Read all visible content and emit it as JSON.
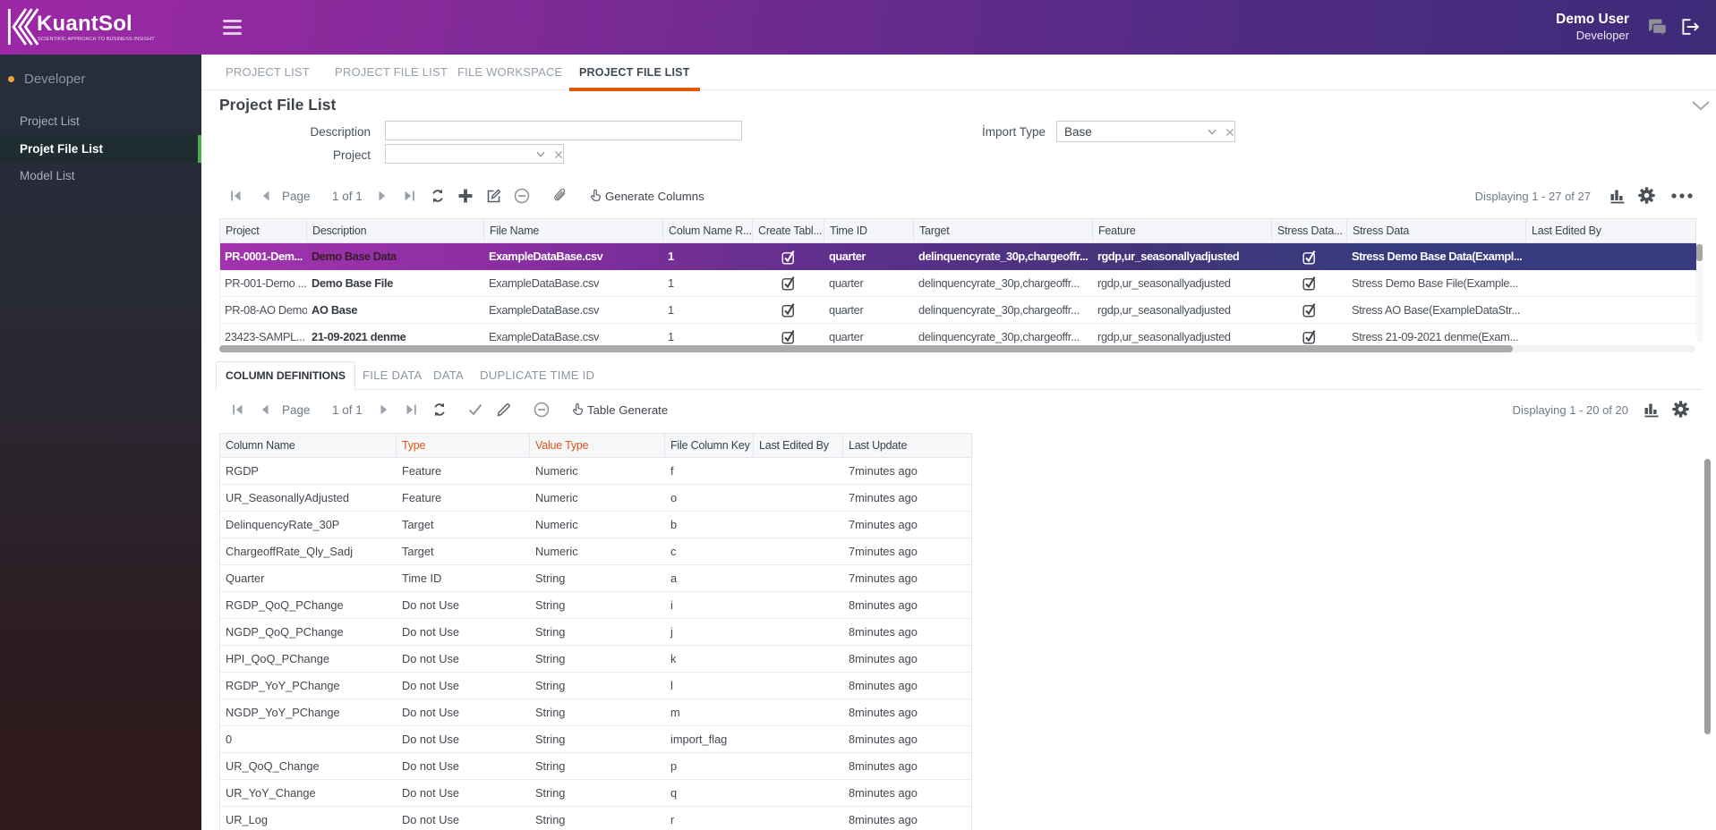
{
  "brand": {
    "name": "KuantSol",
    "tagline": "SCIENTIFIC APPROACH TO BUSINESS INSIGHT"
  },
  "header": {
    "user_name": "Demo User",
    "user_role": "Developer"
  },
  "sidebar": {
    "section_label": "Developer",
    "items": [
      {
        "label": "Project List",
        "active": false
      },
      {
        "label": "Projet File List",
        "active": true
      },
      {
        "label": "Model List",
        "active": false
      }
    ]
  },
  "tabs": [
    {
      "label": "PROJECT LIST",
      "active": false
    },
    {
      "label": "PROJECT FILE LIST",
      "active": false
    },
    {
      "label": "FILE WORKSPACE",
      "active": false
    },
    {
      "label": "PROJECT FILE LIST",
      "active": true
    }
  ],
  "page": {
    "title": "Project File List"
  },
  "filters": {
    "description_label": "Description",
    "description_value": "",
    "project_label": "Project",
    "project_value": "",
    "import_type_label": "İmport Type",
    "import_type_value": "Base"
  },
  "toolbar_top": {
    "page_label": "Page",
    "page_value": "1 of 1",
    "generate_label": "Generate Columns",
    "displaying": "Displaying 1 - 27 of 27"
  },
  "grid1": {
    "columns": [
      "Project",
      "Description",
      "File Name",
      "Colum Name R...",
      "Create Tabl...",
      "Time ID",
      "Target",
      "Feature",
      "Stress Data...",
      "Stress Data",
      "Last Edited By"
    ],
    "rows": [
      {
        "project": "PR-0001-Dem...",
        "description": "Demo Base Data",
        "file_name": "ExampleDataBase.csv",
        "colum_name_row": "1",
        "create_table": true,
        "time_id": "quarter",
        "target": "delinquencyrate_30p,chargeoffr...",
        "feature": "rgdp,ur_seasonallyadjusted",
        "stress_data_flag": true,
        "stress_data": "Stress Demo Base Data(Exampl...",
        "last_edited_by": "",
        "selected": true
      },
      {
        "project": "PR-001-Demo ...",
        "description": "Demo Base File",
        "file_name": "ExampleDataBase.csv",
        "colum_name_row": "1",
        "create_table": true,
        "time_id": "quarter",
        "target": "delinquencyrate_30p,chargeoffr...",
        "feature": "rgdp,ur_seasonallyadjusted",
        "stress_data_flag": true,
        "stress_data": "Stress Demo Base File(Example...",
        "last_edited_by": "",
        "selected": false
      },
      {
        "project": "PR-08-AO Demo",
        "description": "AO Base",
        "file_name": "ExampleDataBase.csv",
        "colum_name_row": "1",
        "create_table": true,
        "time_id": "quarter",
        "target": "delinquencyrate_30p,chargeoffr...",
        "feature": "rgdp,ur_seasonallyadjusted",
        "stress_data_flag": true,
        "stress_data": "Stress AO Base(ExampleDataStr...",
        "last_edited_by": "",
        "selected": false
      },
      {
        "project": "23423-SAMPL...",
        "description": "21-09-2021 denme",
        "file_name": "ExampleDataBase.csv",
        "colum_name_row": "1",
        "create_table": true,
        "time_id": "quarter",
        "target": "delinquencyrate_30p,chargeoffr...",
        "feature": "rgdp,ur_seasonallyadjusted",
        "stress_data_flag": true,
        "stress_data": "Stress 21-09-2021 denme(Exam...",
        "last_edited_by": "",
        "selected": false
      }
    ]
  },
  "detail_tabs": [
    {
      "label": "COLUMN DEFINITIONS",
      "active": true
    },
    {
      "label": "FILE DATA",
      "active": false
    },
    {
      "label": "DATA",
      "active": false
    },
    {
      "label": "DUPLICATE TIME ID",
      "active": false
    }
  ],
  "toolbar_bottom": {
    "page_label": "Page",
    "page_value": "1 of 1",
    "generate_label": "Table Generate",
    "displaying": "Displaying 1 - 20 of 20"
  },
  "grid2": {
    "columns": [
      "Column Name",
      "Type",
      "Value Type",
      "File Column Key",
      "Last Edited By",
      "Last Update"
    ],
    "orange_columns": [
      "Type",
      "Value Type"
    ],
    "rows": [
      {
        "column_name": "RGDP",
        "type": "Feature",
        "value_type": "Numeric",
        "file_column_key": "f",
        "last_edited_by": "",
        "last_update": "7minutes ago"
      },
      {
        "column_name": "UR_SeasonallyAdjusted",
        "type": "Feature",
        "value_type": "Numeric",
        "file_column_key": "o",
        "last_edited_by": "",
        "last_update": "7minutes ago"
      },
      {
        "column_name": "DelinquencyRate_30P",
        "type": "Target",
        "value_type": "Numeric",
        "file_column_key": "b",
        "last_edited_by": "",
        "last_update": "7minutes ago"
      },
      {
        "column_name": "ChargeoffRate_Qly_Sadj",
        "type": "Target",
        "value_type": "Numeric",
        "file_column_key": "c",
        "last_edited_by": "",
        "last_update": "7minutes ago"
      },
      {
        "column_name": "Quarter",
        "type": "Time ID",
        "value_type": "String",
        "file_column_key": "a",
        "last_edited_by": "",
        "last_update": "7minutes ago"
      },
      {
        "column_name": "RGDP_QoQ_PChange",
        "type": "Do not Use",
        "value_type": "String",
        "file_column_key": "i",
        "last_edited_by": "",
        "last_update": "8minutes ago"
      },
      {
        "column_name": "NGDP_QoQ_PChange",
        "type": "Do not Use",
        "value_type": "String",
        "file_column_key": "j",
        "last_edited_by": "",
        "last_update": "8minutes ago"
      },
      {
        "column_name": "HPI_QoQ_PChange",
        "type": "Do not Use",
        "value_type": "String",
        "file_column_key": "k",
        "last_edited_by": "",
        "last_update": "8minutes ago"
      },
      {
        "column_name": "RGDP_YoY_PChange",
        "type": "Do not Use",
        "value_type": "String",
        "file_column_key": "l",
        "last_edited_by": "",
        "last_update": "8minutes ago"
      },
      {
        "column_name": "NGDP_YoY_PChange",
        "type": "Do not Use",
        "value_type": "String",
        "file_column_key": "m",
        "last_edited_by": "",
        "last_update": "8minutes ago"
      },
      {
        "column_name": "0",
        "type": "Do not Use",
        "value_type": "String",
        "file_column_key": "import_flag",
        "last_edited_by": "",
        "last_update": "8minutes ago"
      },
      {
        "column_name": "UR_QoQ_Change",
        "type": "Do not Use",
        "value_type": "String",
        "file_column_key": "p",
        "last_edited_by": "",
        "last_update": "8minutes ago"
      },
      {
        "column_name": "UR_YoY_Change",
        "type": "Do not Use",
        "value_type": "String",
        "file_column_key": "q",
        "last_edited_by": "",
        "last_update": "8minutes ago"
      },
      {
        "column_name": "UR_Log",
        "type": "Do not Use",
        "value_type": "String",
        "file_column_key": "r",
        "last_edited_by": "",
        "last_update": "8minutes ago"
      }
    ]
  }
}
